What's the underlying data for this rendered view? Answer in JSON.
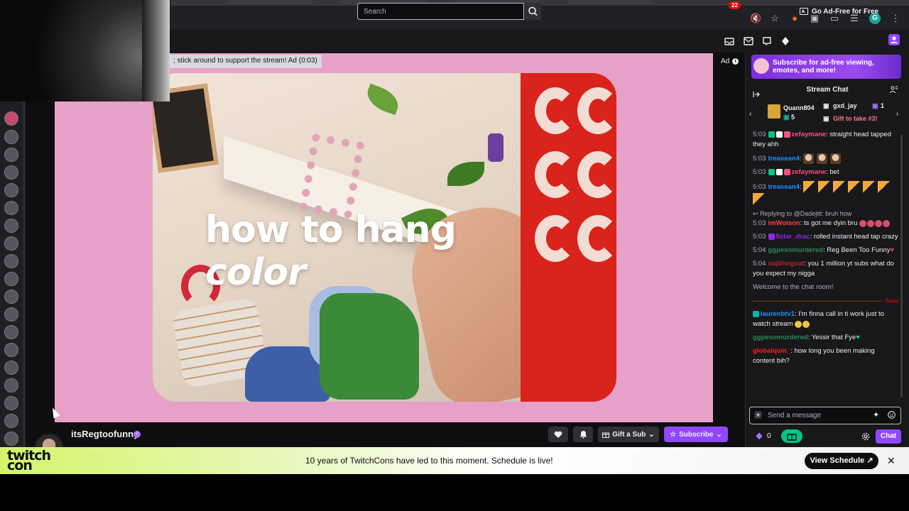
{
  "header": {
    "search_placeholder": "Search",
    "notification_count": "22",
    "ad_free_label": "Go Ad-Free for Free"
  },
  "player": {
    "ad_banner": "; stick around to support the stream! Ad (0:03)",
    "ad_label": "Ad",
    "video_title_a": "how to hang",
    "video_title_b": "color"
  },
  "channel": {
    "name": "itsRegtoofunny",
    "gift_sub_label": "Gift a Sub",
    "subscribe_label": "Subscribe"
  },
  "chat": {
    "promo_text": "Subscribe for ad-free viewing, emotes, and more!",
    "title": "Stream Chat",
    "gift_user1": "Quann804",
    "gift_user1_count": "5",
    "gift_user2": "gxd_jay",
    "gift_user2_count": "1",
    "gift_cta": "Gift to take #3!",
    "messages": [
      {
        "time": "5:03",
        "user": "zefaymane",
        "color": "#ff4f7a",
        "text": ": straight head tapped they ahh"
      },
      {
        "time": "5:03",
        "user": "treasean4",
        "color": "#1e90ff",
        "text": ":"
      },
      {
        "time": "5:03",
        "user": "zefaymane",
        "color": "#ff4f7a",
        "text": ": bet"
      },
      {
        "time": "5:03",
        "user": "treasean4",
        "color": "#1e90ff",
        "text": ":"
      },
      {
        "reply": "Replying to @Dadejitt: bruh how"
      },
      {
        "time": "5:03",
        "user": "imWoison",
        "color": "#ff4040",
        "text": ": ts got me dyin bru"
      },
      {
        "time": "5:03",
        "user": "5star_drac",
        "color": "#8a2be2",
        "text": ": rolled instant head tap crazy"
      },
      {
        "time": "5:04",
        "user": "ggpesomurdered",
        "color": "#2e8b57",
        "text": ": Reg Been Too Funny"
      },
      {
        "time": "5:04",
        "user": "najithegoat",
        "color": "#b22222",
        "text": ": you 1 million yt subs what do you expect my nigga"
      }
    ],
    "welcome": "Welcome to the chat room!",
    "new_label": "New",
    "new_messages": [
      {
        "user": "laurenbtv1",
        "color": "#1e90ff",
        "text": ": I'm finna call in ti work just to watch stream"
      },
      {
        "user": "ggpesomurdered",
        "color": "#2e8b57",
        "text": ": Yessir that Fye"
      },
      {
        "user": "globalquin_",
        "color": "#ff2020",
        "text": ": how long you been making content bih?"
      }
    ],
    "input_placeholder": "Send a message",
    "points": "0",
    "send_label": "Chat"
  },
  "banner": {
    "logo_line1": "twitch",
    "logo_line2": "con",
    "text": "10 years of TwitchCons have led to this moment. Schedule is live!",
    "button_label": "View Schedule ↗",
    "close_glyph": "✕"
  },
  "colors": {
    "accent": "#9147ff",
    "video_bg": "#e7a0c8"
  }
}
